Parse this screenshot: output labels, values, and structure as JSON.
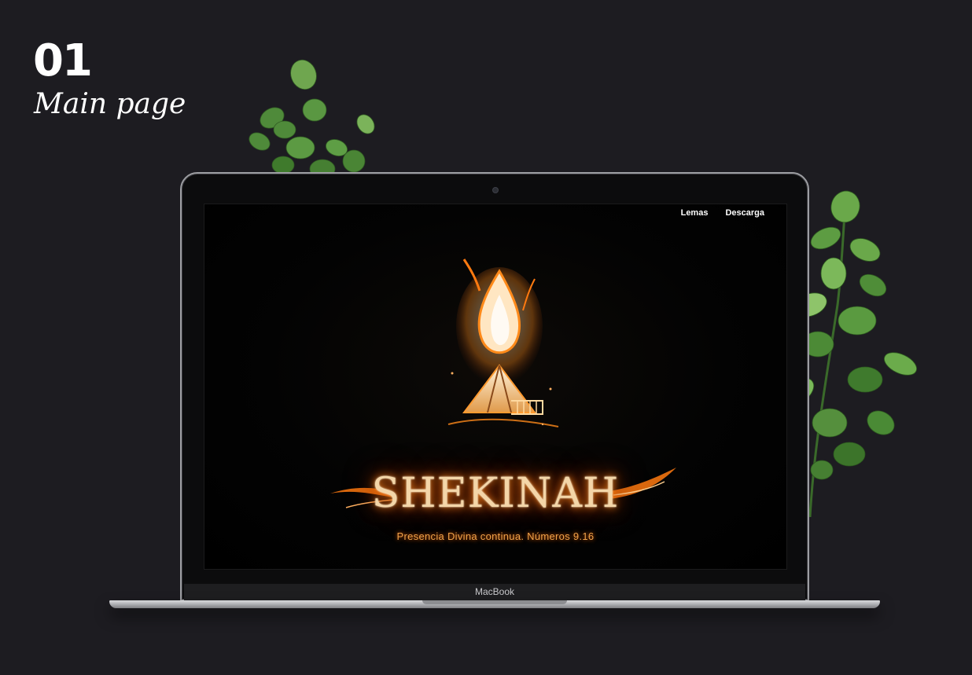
{
  "case": {
    "number": "01",
    "title": "Main page"
  },
  "site": {
    "nav": [
      "Lemas",
      "Descarga"
    ],
    "brand": "SHEKINAH",
    "tagline": "Presencia Divina continua. Números 9.16"
  },
  "device": {
    "label": "MacBook"
  },
  "icons": {
    "emblem": "flame-over-tent-icon",
    "plants": "leaf-plant-decoration"
  },
  "colors": {
    "background": "#1d1c21",
    "fire_core": "#fff1d8",
    "fire_glow": "#ff8a1a",
    "tagline": "#f0a24a"
  }
}
